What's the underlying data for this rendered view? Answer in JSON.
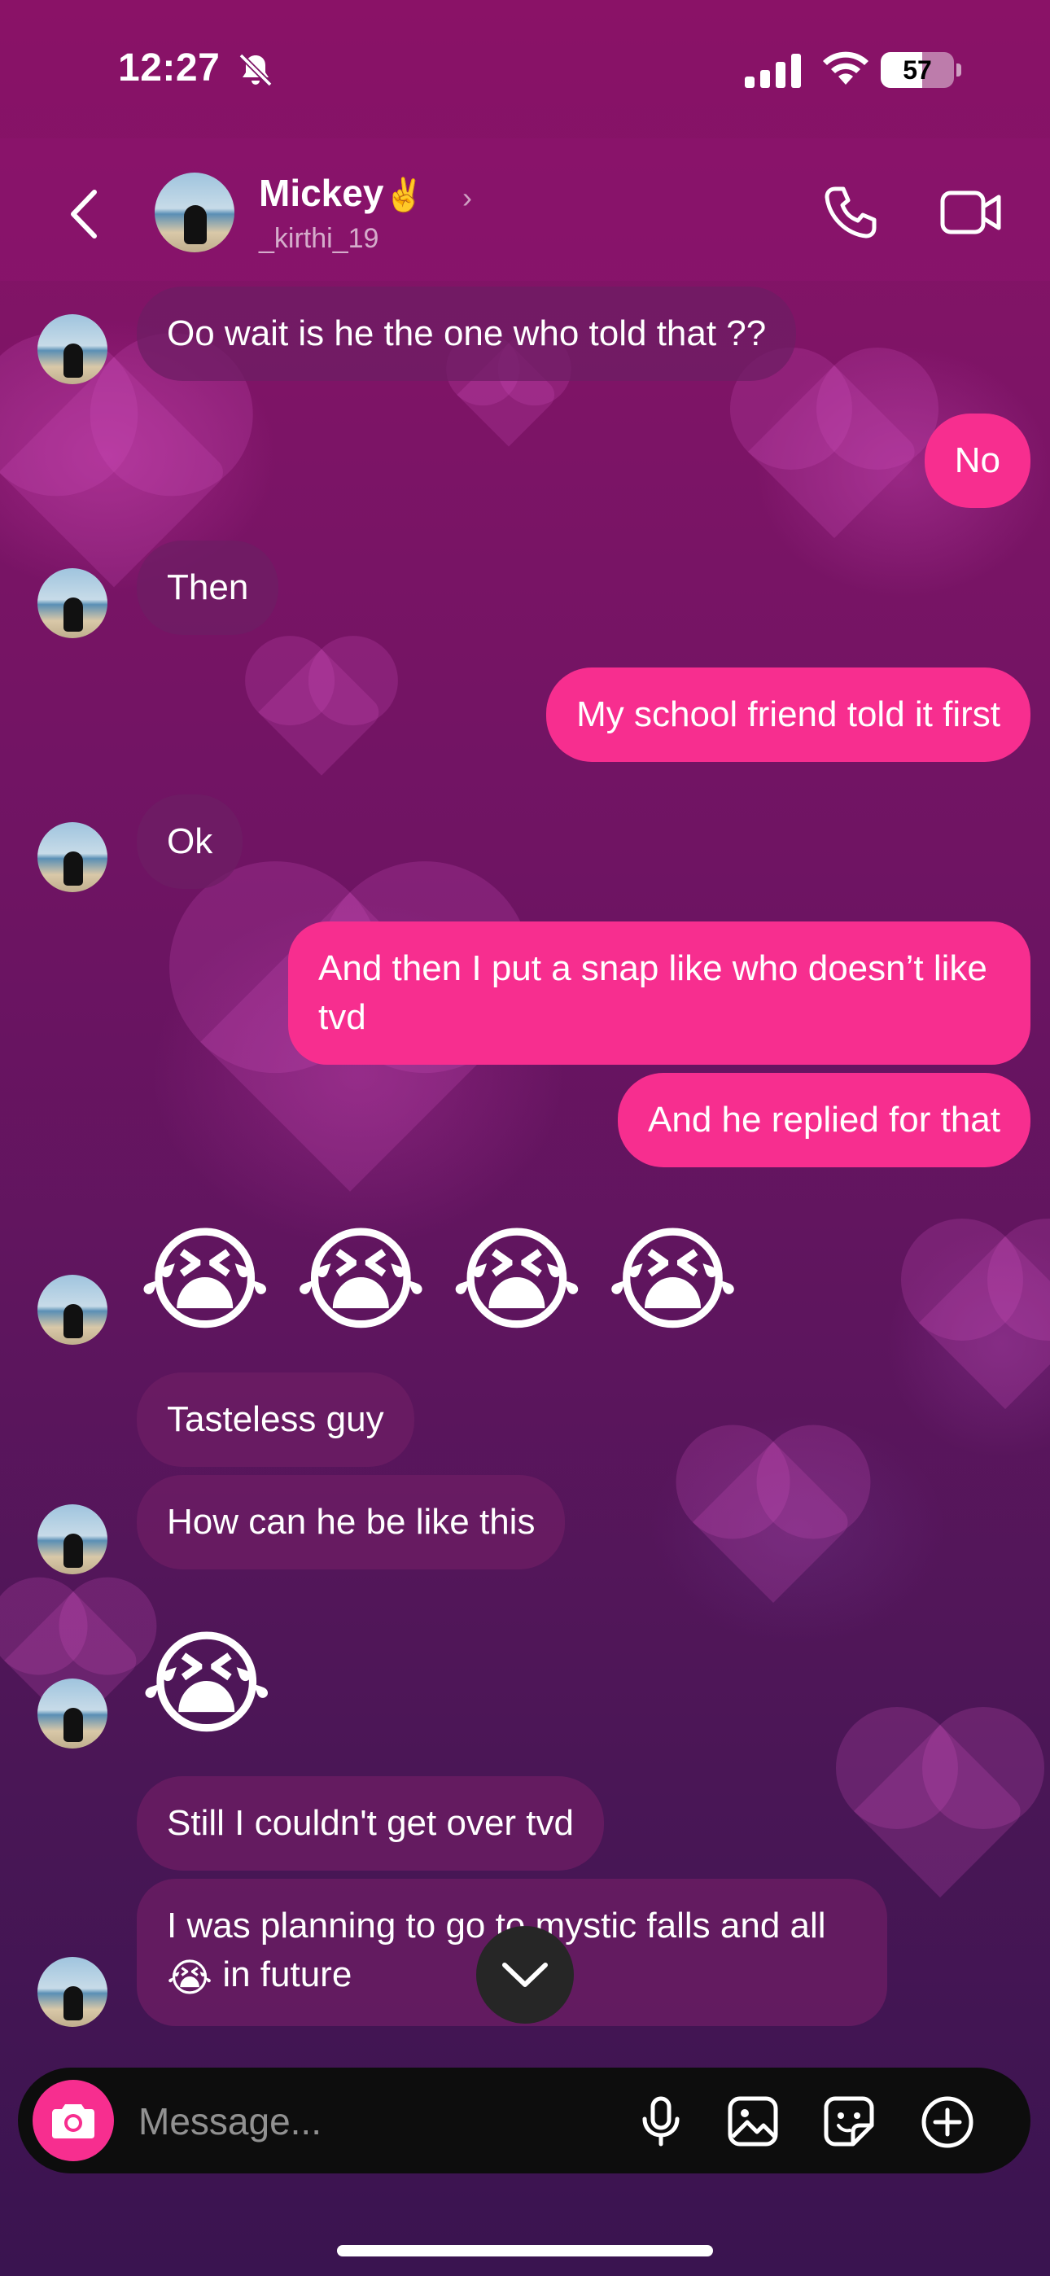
{
  "status": {
    "time": "12:27",
    "battery": "57",
    "battery_level": 0.57
  },
  "header": {
    "name": "Mickey",
    "name_emoji": "✌️",
    "username": "_kirthi_19"
  },
  "messages": [
    {
      "from": "them",
      "text": "Oo wait is he the one who told that ??"
    },
    {
      "from": "me",
      "text": "No"
    },
    {
      "from": "them",
      "text": "Then"
    },
    {
      "from": "me",
      "text": "My school friend told it first"
    },
    {
      "from": "them",
      "text": "Ok"
    },
    {
      "from": "me",
      "text": "And then I put a snap like who doesn’t like tvd"
    },
    {
      "from": "me",
      "text": "And he replied for that"
    },
    {
      "from": "them",
      "text": "😭😭😭😭"
    },
    {
      "from": "them",
      "text": "Tasteless guy"
    },
    {
      "from": "them",
      "text": "How can he be like this"
    },
    {
      "from": "them",
      "text": "😭"
    },
    {
      "from": "them",
      "text": "Still I couldn't get over tvd"
    },
    {
      "from": "them",
      "text_before": "I was planning to go to mystic falls and all",
      "emoji": "😭",
      "text_after": " in future"
    }
  ],
  "composer": {
    "placeholder": "Message..."
  },
  "icons": {
    "back": "chevron-left-icon",
    "call": "phone-icon",
    "video": "video-camera-icon",
    "camera": "camera-icon",
    "mic": "microphone-icon",
    "gallery": "image-icon",
    "sticker": "sticker-icon",
    "more": "plus-circle-icon",
    "scroll": "chevron-down-icon"
  },
  "colors": {
    "outgoing_bubble": "#f72e8f",
    "incoming_bubble": "#6e1e64",
    "camera_button": "#f72e8f"
  }
}
